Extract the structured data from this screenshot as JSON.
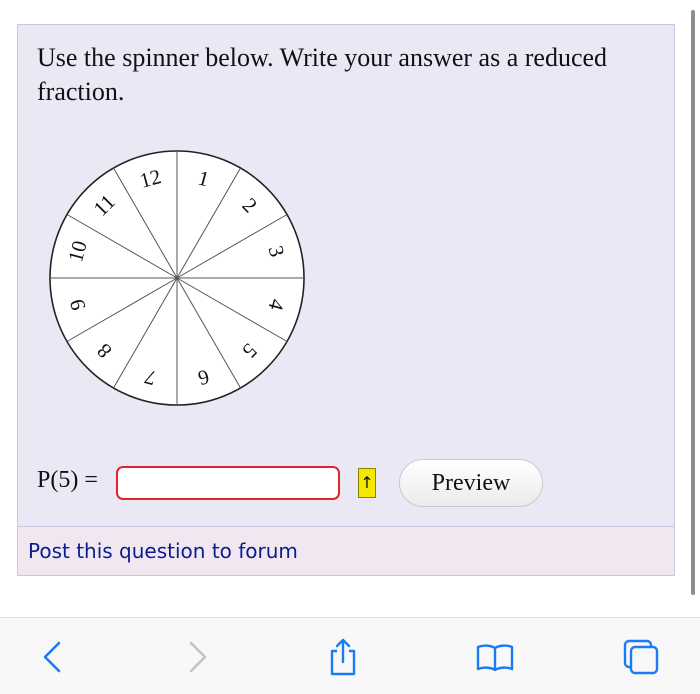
{
  "question": {
    "text": "Use the spinner below. Write your answer as a reduced fraction."
  },
  "spinner": {
    "sections": 12,
    "labels": [
      "12",
      "1",
      "2",
      "3",
      "4",
      "5",
      "6",
      "7",
      "8",
      "9",
      "10",
      "11"
    ]
  },
  "answer": {
    "label": "P(5) =",
    "value": "",
    "arrow_symbol": "↑",
    "preview_label": "Preview"
  },
  "forum": {
    "link_text": "Post this question to forum"
  },
  "browser_toolbar": {
    "icons": [
      "back-icon",
      "forward-icon",
      "share-icon",
      "bookmarks-icon",
      "tabs-icon"
    ]
  },
  "colors": {
    "card_bg": "#ebe8f6",
    "input_border": "#e0242b",
    "arrow_button": "#f4e800",
    "forum_link": "#0b1c8f",
    "toolbar_icon": "#1a7cf2"
  }
}
